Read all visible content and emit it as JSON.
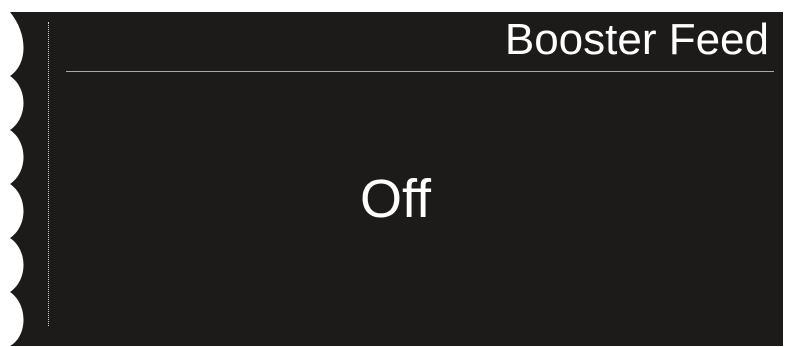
{
  "tag": {
    "title": "Booster Feed",
    "status": "Off"
  },
  "colors": {
    "panel_background": "#1c1b1a",
    "text": "#ffffff",
    "divider": "#a8a8a8"
  }
}
